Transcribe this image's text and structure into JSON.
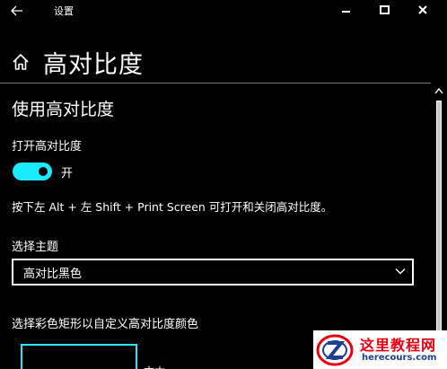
{
  "window": {
    "title": "设置",
    "back_icon": "arrow-left-icon",
    "controls": [
      "minimize-icon",
      "maximize-icon",
      "close-icon"
    ]
  },
  "header": {
    "home_icon": "home-icon",
    "title": "高对比度"
  },
  "section": {
    "title": "使用高对比度",
    "toggle_label": "打开高对比度",
    "toggle_state": "开",
    "toggle_on": true,
    "shortcut_text": "按下左 Alt + 左 Shift + Print Screen 可打开和关闭高对比度。",
    "theme_label": "选择主题",
    "theme_value": "高对比黑色",
    "color_hint": "选择彩色矩形以自定义高对比度颜色",
    "swatch_label": "文本"
  },
  "colors": {
    "accent": "#1aebff",
    "background": "#000000",
    "foreground": "#ffffff"
  },
  "watermark": {
    "title": "这里教程网",
    "url": "herecours.com"
  }
}
